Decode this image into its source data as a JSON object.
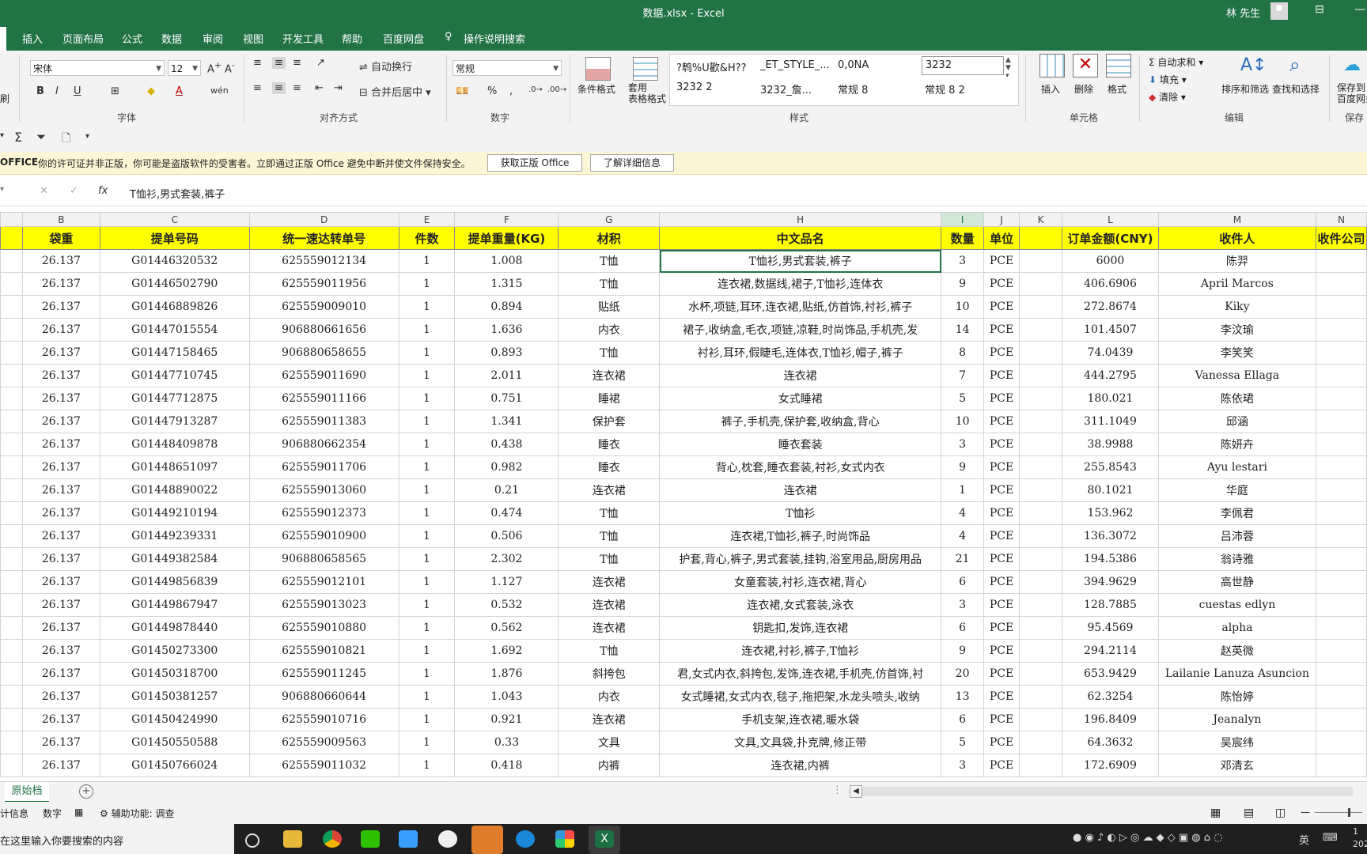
{
  "window": {
    "title": "数据.xlsx  -  Excel",
    "user": "林 先生"
  },
  "tabs": [
    "插入",
    "页面布局",
    "公式",
    "数据",
    "审阅",
    "视图",
    "开发工具",
    "帮助",
    "百度网盘",
    "操作说明搜索"
  ],
  "ribbon": {
    "font_name": "宋体",
    "font_size": "12",
    "wrap_text": "自动换行",
    "merge_center": "合并后居中",
    "number_format": "常规",
    "percent": "%",
    "cond_format": "条件格式",
    "table_format": "套用\n表格格式",
    "styles": [
      "?鹎%U歡&H??",
      "_ET_STYLE_...",
      "0,0NA",
      "3232",
      "3232 2",
      "3232_詹...",
      "常规 8",
      "常规 8 2"
    ],
    "insert": "插入",
    "delete": "删除",
    "format": "格式",
    "autosum": "自动求和",
    "fill": "填充",
    "clear": "清除",
    "sort_filter": "排序和筛选",
    "find_select": "查找和选择",
    "save_baidu": "保存到\n百度网盘",
    "groups": [
      "字体",
      "对齐方式",
      "数字",
      "样式",
      "单元格",
      "编辑",
      "保存"
    ],
    "left_edge": "刷"
  },
  "warning": {
    "brand": "OFFICE",
    "message": "你的许可证并非正版，你可能是盗版软件的受害者。立即通过正版 Office 避免中断并使文件保持安全。",
    "btn_get": "获取正版 Office",
    "btn_more": "了解详细信息"
  },
  "formula": {
    "content": "T恤衫,男式套装,裤子"
  },
  "columns": [
    "B",
    "C",
    "D",
    "E",
    "F",
    "G",
    "H",
    "I",
    "J",
    "K",
    "L",
    "M",
    "N"
  ],
  "headers": [
    "袋重",
    "提单号码",
    "统一速达转单号",
    "件数",
    "提单重量(KG)",
    "材积",
    "中文品名",
    "数量",
    "单位",
    "",
    "订单金额(CNY)",
    "收件人",
    "收件公司"
  ],
  "rows": [
    [
      "26.137",
      "G01446320532",
      "625559012134",
      "1",
      "1.008",
      "T恤",
      "T恤衫,男式套装,裤子",
      "3",
      "PCE",
      "",
      "6000",
      "陈羿",
      ""
    ],
    [
      "26.137",
      "G01446502790",
      "625559011956",
      "1",
      "1.315",
      "T恤",
      "连衣裙,数据线,裙子,T恤衫,连体衣",
      "9",
      "PCE",
      "",
      "406.6906",
      "April Marcos",
      ""
    ],
    [
      "26.137",
      "G01446889826",
      "625559009010",
      "1",
      "0.894",
      "贴纸",
      "水杯,项链,耳环,连衣裙,贴纸,仿首饰,衬衫,裤子",
      "10",
      "PCE",
      "",
      "272.8674",
      "Kiky",
      ""
    ],
    [
      "26.137",
      "G01447015554",
      "906880661656",
      "1",
      "1.636",
      "内衣",
      "裙子,收纳盒,毛衣,项链,凉鞋,时尚饰品,手机壳,发",
      "14",
      "PCE",
      "",
      "101.4507",
      "李汶瑜",
      ""
    ],
    [
      "26.137",
      "G01447158465",
      "906880658655",
      "1",
      "0.893",
      "T恤",
      "衬衫,耳环,假睫毛,连体衣,T恤衫,帽子,裤子",
      "8",
      "PCE",
      "",
      "74.0439",
      "李笑笑",
      ""
    ],
    [
      "26.137",
      "G01447710745",
      "625559011690",
      "1",
      "2.011",
      "连衣裙",
      "连衣裙",
      "7",
      "PCE",
      "",
      "444.2795",
      "Vanessa Ellaga",
      ""
    ],
    [
      "26.137",
      "G01447712875",
      "625559011166",
      "1",
      "0.751",
      "睡裙",
      "女式睡裙",
      "5",
      "PCE",
      "",
      "180.021",
      "陈依珺",
      ""
    ],
    [
      "26.137",
      "G01447913287",
      "625559011383",
      "1",
      "1.341",
      "保护套",
      "裤子,手机壳,保护套,收纳盒,背心",
      "10",
      "PCE",
      "",
      "311.1049",
      "邱涵",
      ""
    ],
    [
      "26.137",
      "G01448409878",
      "906880662354",
      "1",
      "0.438",
      "睡衣",
      "睡衣套装",
      "3",
      "PCE",
      "",
      "38.9988",
      "陈妍卉",
      ""
    ],
    [
      "26.137",
      "G01448651097",
      "625559011706",
      "1",
      "0.982",
      "睡衣",
      "背心,枕套,睡衣套装,衬衫,女式内衣",
      "9",
      "PCE",
      "",
      "255.8543",
      "Ayu lestari",
      ""
    ],
    [
      "26.137",
      "G01448890022",
      "625559013060",
      "1",
      "0.21",
      "连衣裙",
      "连衣裙",
      "1",
      "PCE",
      "",
      "80.1021",
      "华庭",
      ""
    ],
    [
      "26.137",
      "G01449210194",
      "625559012373",
      "1",
      "0.474",
      "T恤",
      "T恤衫",
      "4",
      "PCE",
      "",
      "153.962",
      "李佩君",
      ""
    ],
    [
      "26.137",
      "G01449239331",
      "625559010900",
      "1",
      "0.506",
      "T恤",
      "连衣裙,T恤衫,裤子,时尚饰品",
      "4",
      "PCE",
      "",
      "136.3072",
      "吕沛蓉",
      ""
    ],
    [
      "26.137",
      "G01449382584",
      "906880658565",
      "1",
      "2.302",
      "T恤",
      "护套,背心,裤子,男式套装,挂钩,浴室用品,厨房用品",
      "21",
      "PCE",
      "",
      "194.5386",
      "翁诗雅",
      ""
    ],
    [
      "26.137",
      "G01449856839",
      "625559012101",
      "1",
      "1.127",
      "连衣裙",
      "女童套装,衬衫,连衣裙,背心",
      "6",
      "PCE",
      "",
      "394.9629",
      "高世静",
      ""
    ],
    [
      "26.137",
      "G01449867947",
      "625559013023",
      "1",
      "0.532",
      "连衣裙",
      "连衣裙,女式套装,泳衣",
      "3",
      "PCE",
      "",
      "128.7885",
      "cuestas edlyn",
      ""
    ],
    [
      "26.137",
      "G01449878440",
      "625559010880",
      "1",
      "0.562",
      "连衣裙",
      "钥匙扣,发饰,连衣裙",
      "6",
      "PCE",
      "",
      "95.4569",
      "alpha",
      ""
    ],
    [
      "26.137",
      "G01450273300",
      "625559010821",
      "1",
      "1.692",
      "T恤",
      "连衣裙,衬衫,裤子,T恤衫",
      "9",
      "PCE",
      "",
      "294.2114",
      "赵英微",
      ""
    ],
    [
      "26.137",
      "G01450318700",
      "625559011245",
      "1",
      "1.876",
      "斜挎包",
      "君,女式内衣,斜挎包,发饰,连衣裙,手机壳,仿首饰,衬",
      "20",
      "PCE",
      "",
      "653.9429",
      "Lailanie Lanuza Asuncion",
      ""
    ],
    [
      "26.137",
      "G01450381257",
      "906880660644",
      "1",
      "1.043",
      "内衣",
      "女式睡裙,女式内衣,毯子,拖把架,水龙头喷头,收纳",
      "13",
      "PCE",
      "",
      "62.3254",
      "陈怡婷",
      ""
    ],
    [
      "26.137",
      "G01450424990",
      "625559010716",
      "1",
      "0.921",
      "连衣裙",
      "手机支架,连衣裙,暖水袋",
      "6",
      "PCE",
      "",
      "196.8409",
      "Jeanalyn",
      ""
    ],
    [
      "26.137",
      "G01450550588",
      "625559009563",
      "1",
      "0.33",
      "文具",
      "文具,文具袋,扑克牌,修正带",
      "5",
      "PCE",
      "",
      "64.3632",
      "吴宸纬",
      ""
    ],
    [
      "26.137",
      "G01450766024",
      "625559011032",
      "1",
      "0.418",
      "内裤",
      "连衣裙,内裤",
      "3",
      "PCE",
      "",
      "172.6909",
      "邓清玄",
      ""
    ]
  ],
  "sheet": {
    "name": "原始档"
  },
  "status": {
    "left": "计信息",
    "mode": "数字",
    "accessibility": "辅助功能: 调查"
  },
  "taskbar": {
    "search": "在这里输入你要搜索的内容",
    "lang": "英",
    "clock_time": "1",
    "clock_year": "202"
  },
  "colors": {
    "excel_green": "#217346",
    "header_yellow": "#ffff00",
    "warn_bg": "#fcf6d6"
  }
}
